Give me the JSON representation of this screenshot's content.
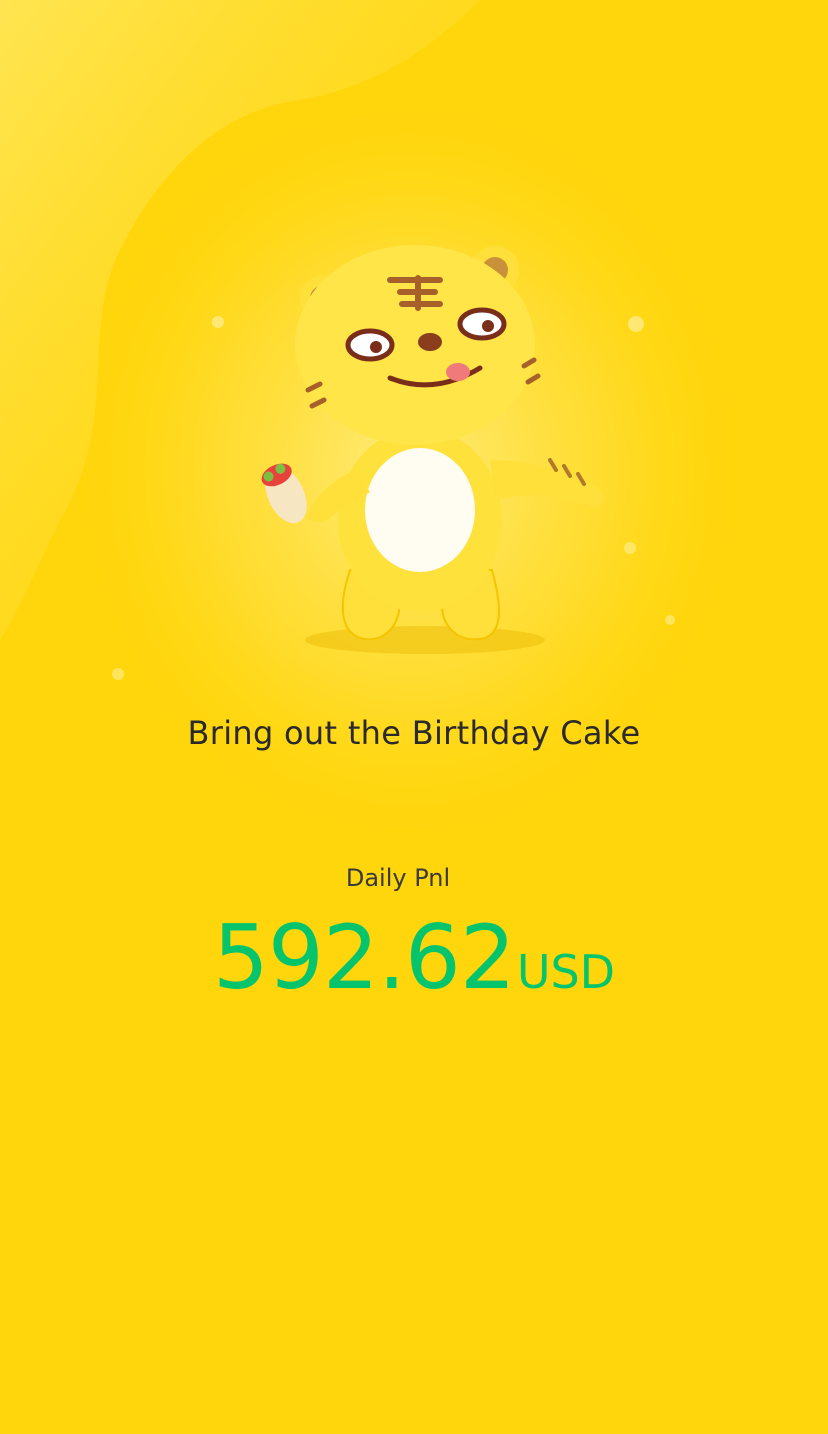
{
  "card": {
    "headline": "Bring out the Birthday Cake",
    "pnl_label": "Daily Pnl",
    "pnl_value": "592.62",
    "pnl_unit": "USD"
  },
  "mascot": {
    "icon": "tiger-mascot-with-burrito"
  },
  "colors": {
    "background": "#FFD60C",
    "glow": "#FFE56A",
    "headline_text": "#2A2A2A",
    "pnl_value": "#05C46B"
  }
}
